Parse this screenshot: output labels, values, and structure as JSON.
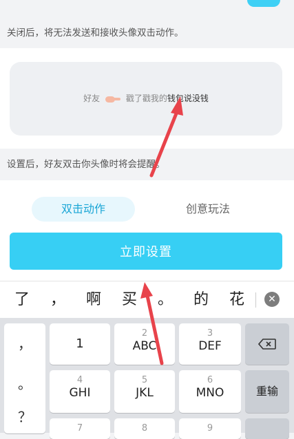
{
  "settings": {
    "close_desc": "关闭后，将无法发送和接收头像双击动作。",
    "preview": {
      "friend": "好友",
      "action": "戳了戳我的",
      "suffix": "钱包说没钱"
    },
    "set_desc": "设置后，好友双击你头像时将会提醒。"
  },
  "tabs": [
    {
      "label": "双击动作",
      "active": true
    },
    {
      "label": "创意玩法",
      "active": false
    }
  ],
  "setup_button": "立即设置",
  "candidates": [
    "了",
    "，",
    "啊",
    "买",
    "。",
    "的",
    "花"
  ],
  "keyboard": {
    "symbols": [
      "，",
      "。",
      "？"
    ],
    "keys": [
      {
        "num": "",
        "letters": "1"
      },
      {
        "num": "2",
        "letters": "ABC"
      },
      {
        "num": "3",
        "letters": "DEF"
      },
      {
        "num": "4",
        "letters": "GHI"
      },
      {
        "num": "5",
        "letters": "JKL"
      },
      {
        "num": "6",
        "letters": "MNO"
      },
      {
        "num": "7",
        "letters": ""
      },
      {
        "num": "8",
        "letters": ""
      },
      {
        "num": "9",
        "letters": ""
      }
    ],
    "reinput": "重输"
  },
  "colors": {
    "accent": "#37cff4",
    "annotation_arrow": "#e8434b"
  }
}
